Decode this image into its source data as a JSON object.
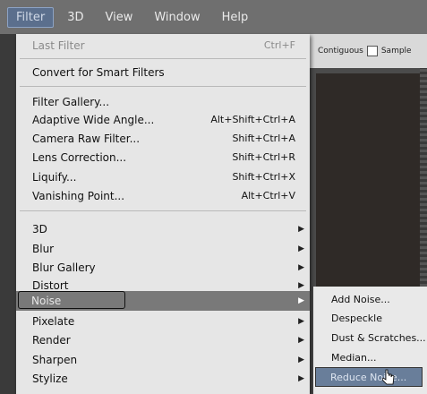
{
  "menubar": {
    "items": [
      "Filter",
      "3D",
      "View",
      "Window",
      "Help"
    ]
  },
  "options_bar": {
    "contiguous_label": "Contiguous",
    "sample_label": "Sample"
  },
  "filter_menu": {
    "last_filter": {
      "label": "Last Filter",
      "shortcut": "Ctrl+F"
    },
    "convert": {
      "label": "Convert for Smart Filters"
    },
    "filter_gallery": {
      "label": "Filter Gallery..."
    },
    "adaptive_wide_angle": {
      "label": "Adaptive Wide Angle...",
      "shortcut": "Alt+Shift+Ctrl+A"
    },
    "camera_raw": {
      "label": "Camera Raw Filter...",
      "shortcut": "Shift+Ctrl+A"
    },
    "lens_correction": {
      "label": "Lens Correction...",
      "shortcut": "Shift+Ctrl+R"
    },
    "liquify": {
      "label": "Liquify...",
      "shortcut": "Shift+Ctrl+X"
    },
    "vanishing_point": {
      "label": "Vanishing Point...",
      "shortcut": "Alt+Ctrl+V"
    },
    "submenus": [
      "3D",
      "Blur",
      "Blur Gallery",
      "Distort",
      "Noise",
      "Pixelate",
      "Render",
      "Sharpen",
      "Stylize"
    ]
  },
  "noise_submenu": {
    "items": [
      "Add Noise...",
      "Despeckle",
      "Dust & Scratches...",
      "Median...",
      "Reduce Noise..."
    ]
  }
}
